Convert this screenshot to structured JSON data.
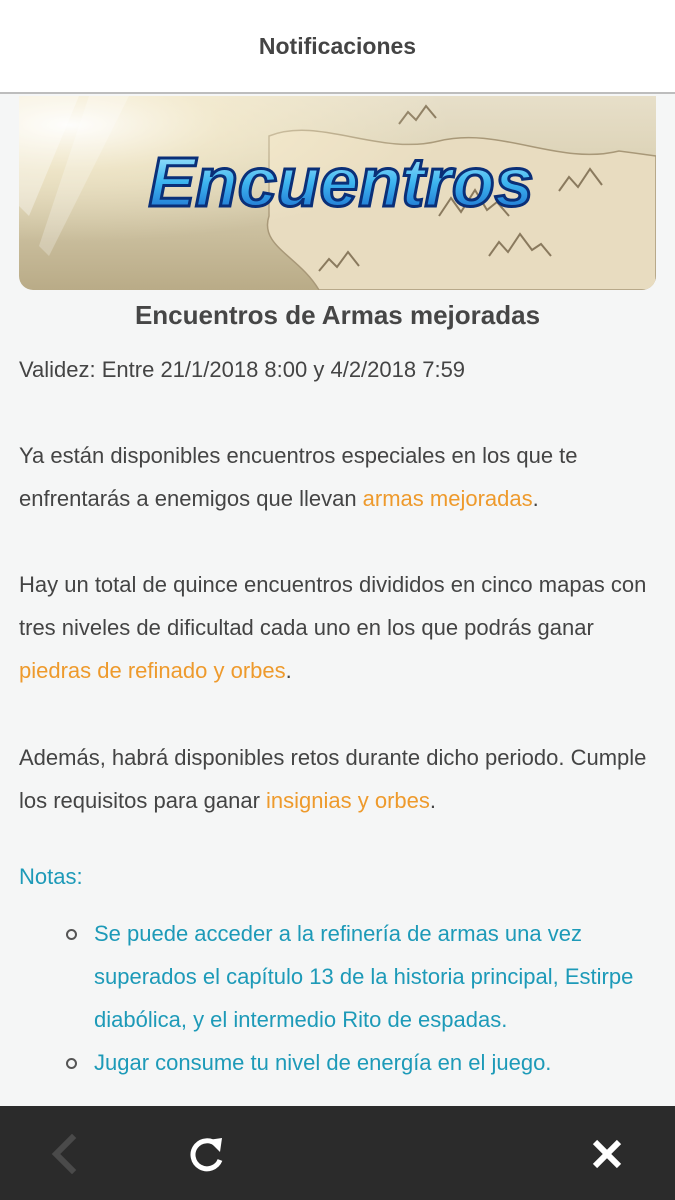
{
  "header": {
    "title": "Notificaciones"
  },
  "banner": {
    "text": "Encuentros"
  },
  "article": {
    "title": "Encuentros de Armas mejoradas",
    "validity": "Validez: Entre 21/1/2018 8:00 y 4/2/2018 7:59",
    "p1": {
      "before": "Ya están disponibles encuentros especiales en los que te enfrentarás a enemigos que llevan ",
      "link": "armas mejoradas",
      "after": "."
    },
    "p2": {
      "before": "Hay un total de quince encuentros divididos en cinco mapas con tres niveles de dificultad cada uno en los que podrás ganar ",
      "link": "piedras de refinado y orbes",
      "after": "."
    },
    "p3": {
      "before": "Además, habrá disponibles retos durante dicho periodo. Cumple los requisitos para ganar ",
      "link": "insignias y orbes",
      "after": "."
    },
    "notes_label": "Notas:",
    "notes": [
      "Se puede acceder a la refinería de armas una vez superados el capítulo 13 de la historia principal, Estirpe diabólica, y el intermedio Rito de espadas.",
      "Jugar consume tu nivel de energía en el juego."
    ]
  },
  "colors": {
    "link": "#ee9a2c",
    "notes": "#1d9ab8",
    "bottom_bar": "#2b2b2b"
  },
  "bottom_bar": {
    "icons": [
      "back-arrow-icon",
      "refresh-icon",
      "close-icon"
    ]
  }
}
